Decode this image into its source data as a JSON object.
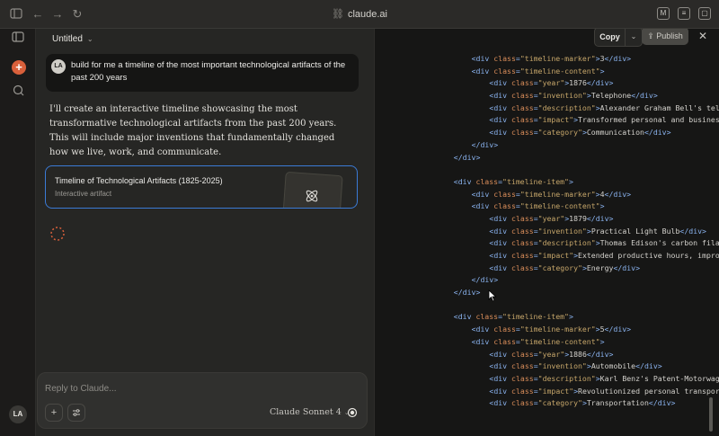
{
  "browser": {
    "url": "claude.ai",
    "ext_label": "M"
  },
  "chat": {
    "title": "Untitled",
    "user_initials": "LA",
    "user_message": "build for me a timeline of the most important technological artifacts of the past 200 years",
    "assistant_message": "I'll create an interactive timeline showcasing the most transformative technological artifacts from the past 200 years. This will include major inventions that fundamentally changed how we live, work, and communicate.",
    "artifact": {
      "title": "Timeline of Technological Artifacts (1825-2025)",
      "subtitle": "Interactive artifact",
      "icon": "atom-icon"
    },
    "composer": {
      "placeholder": "Reply to Claude...",
      "model": "Claude Sonnet 4"
    }
  },
  "sidebar": {
    "avatar_initials": "LA"
  },
  "artifact_panel": {
    "copy_label": "Copy",
    "publish_label": "Publish",
    "code_lines": [
      {
        "indent": 8,
        "type": "div-text",
        "cls": "timeline-marker",
        "text": "3"
      },
      {
        "indent": 8,
        "type": "open",
        "cls": "timeline-content"
      },
      {
        "indent": 12,
        "type": "div-text",
        "cls": "year",
        "text": "1876"
      },
      {
        "indent": 12,
        "type": "div-text",
        "cls": "invention",
        "text": "Telephone"
      },
      {
        "indent": 12,
        "type": "div-text-cut",
        "cls": "description",
        "text": "Alexander Graham Bell's telepho"
      },
      {
        "indent": 12,
        "type": "div-text-cut",
        "cls": "impact",
        "text": "Transformed personal and business co"
      },
      {
        "indent": 12,
        "type": "div-text",
        "cls": "category",
        "text": "Communication"
      },
      {
        "indent": 8,
        "type": "close"
      },
      {
        "indent": 4,
        "type": "close"
      },
      {
        "indent": 0,
        "type": "blank"
      },
      {
        "indent": 4,
        "type": "open",
        "cls": "timeline-item"
      },
      {
        "indent": 8,
        "type": "div-text",
        "cls": "timeline-marker",
        "text": "4"
      },
      {
        "indent": 8,
        "type": "open",
        "cls": "timeline-content"
      },
      {
        "indent": 12,
        "type": "div-text",
        "cls": "year",
        "text": "1879"
      },
      {
        "indent": 12,
        "type": "div-text",
        "cls": "invention",
        "text": "Practical Light Bulb"
      },
      {
        "indent": 12,
        "type": "div-text-cut",
        "cls": "description",
        "text": "Thomas Edison's carbon filament"
      },
      {
        "indent": 12,
        "type": "div-text-cut",
        "cls": "impact",
        "text": "Extended productive hours, improved"
      },
      {
        "indent": 12,
        "type": "div-text",
        "cls": "category",
        "text": "Energy"
      },
      {
        "indent": 8,
        "type": "close"
      },
      {
        "indent": 4,
        "type": "close"
      },
      {
        "indent": 0,
        "type": "blank"
      },
      {
        "indent": 4,
        "type": "open",
        "cls": "timeline-item"
      },
      {
        "indent": 8,
        "type": "div-text",
        "cls": "timeline-marker",
        "text": "5"
      },
      {
        "indent": 8,
        "type": "open",
        "cls": "timeline-content"
      },
      {
        "indent": 12,
        "type": "div-text",
        "cls": "year",
        "text": "1886"
      },
      {
        "indent": 12,
        "type": "div-text",
        "cls": "invention",
        "text": "Automobile"
      },
      {
        "indent": 12,
        "type": "div-text-cut",
        "cls": "description",
        "text": "Karl Benz's Patent-Motorwagen w"
      },
      {
        "indent": 12,
        "type": "div-text-cut",
        "cls": "impact",
        "text": "Revolutionized personal transportatio"
      },
      {
        "indent": 12,
        "type": "div-text",
        "cls": "category",
        "text": "Transportation"
      }
    ]
  },
  "colors": {
    "accent": "#d9603b",
    "artifact_border": "#3b7bd6",
    "code_tag": "#8ab3ef",
    "code_attr": "#d98d5a",
    "code_string": "#c6a66a"
  }
}
